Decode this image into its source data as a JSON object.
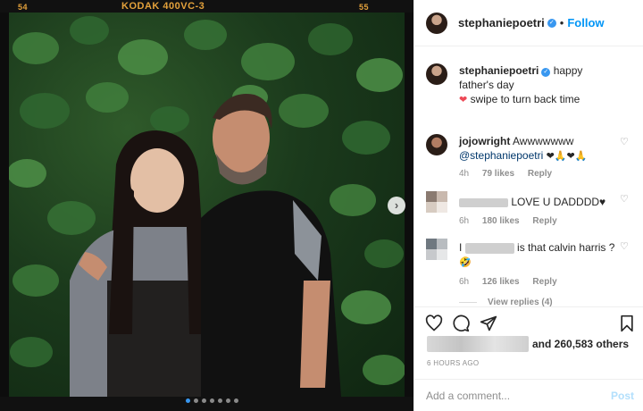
{
  "photo": {
    "film_frame_left": "54",
    "film_brand": "KODAK 400VC-3",
    "film_frame_right": "55",
    "dot_count": 7,
    "active_dot_index": 0
  },
  "header": {
    "username": "stephaniepoetri",
    "separator": "•",
    "follow_label": "Follow"
  },
  "caption": {
    "username": "stephaniepoetri",
    "text_line1": "happy father's day",
    "emoji": "❤",
    "text_line2": "swipe to turn back time"
  },
  "comments": [
    {
      "username": "jojowright",
      "text": "Awwwwwww",
      "mention": "@stephaniepoetri",
      "emojis": "❤🙏❤🙏",
      "time": "4h",
      "likes": "79 likes",
      "reply": "Reply"
    },
    {
      "text": "LOVE U DADDDD♥",
      "time": "6h",
      "likes": "180 likes",
      "reply": "Reply"
    },
    {
      "prefix": "I",
      "text": "is that calvin harris ?",
      "emoji": "🤣",
      "time": "6h",
      "likes": "126 likes",
      "reply": "Reply"
    }
  ],
  "view_replies": "View replies (4)",
  "likes_summary": "and 260,583 others",
  "time_ago": "6 HOURS AGO",
  "add_comment": {
    "placeholder": "Add a comment...",
    "post_label": "Post"
  },
  "colors": {
    "accent": "#0095f6",
    "verified": "#3897f0",
    "heart_red": "#ed4956",
    "film_label": "#e3a13b"
  }
}
